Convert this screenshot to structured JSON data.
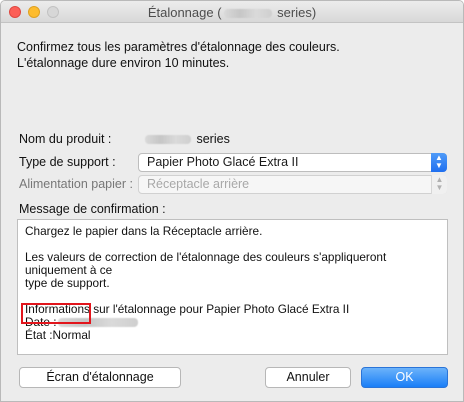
{
  "window": {
    "title_prefix": "Étalonnage (",
    "title_suffix": " series)"
  },
  "intro": {
    "line1": "Confirmez tous les paramètres d'étalonnage des couleurs.",
    "line2": "L'étalonnage dure environ 10 minutes."
  },
  "fields": {
    "product_label": "Nom du produit :",
    "product_value_suffix": "series",
    "media_type_label": "Type de support :",
    "media_type_value": "Papier Photo Glacé Extra II",
    "paper_feed_label": "Alimentation papier :",
    "paper_feed_value": "Réceptacle arrière"
  },
  "message": {
    "label": "Message de confirmation :",
    "line1": "Chargez le papier dans la Réceptacle arrière.",
    "line2": "Les valeurs de correction de l'étalonnage des couleurs s'appliqueront uniquement à ce",
    "line3": "type de support.",
    "line4": "Informations sur l'étalonnage pour Papier Photo Glacé Extra II",
    "line5": "Date :",
    "line6": "État :Normal"
  },
  "buttons": {
    "calibration_screen": "Écran d'étalonnage",
    "cancel": "Annuler",
    "ok": "OK"
  },
  "colors": {
    "highlight": "#e2151c",
    "accent": "#1a7ef7"
  }
}
